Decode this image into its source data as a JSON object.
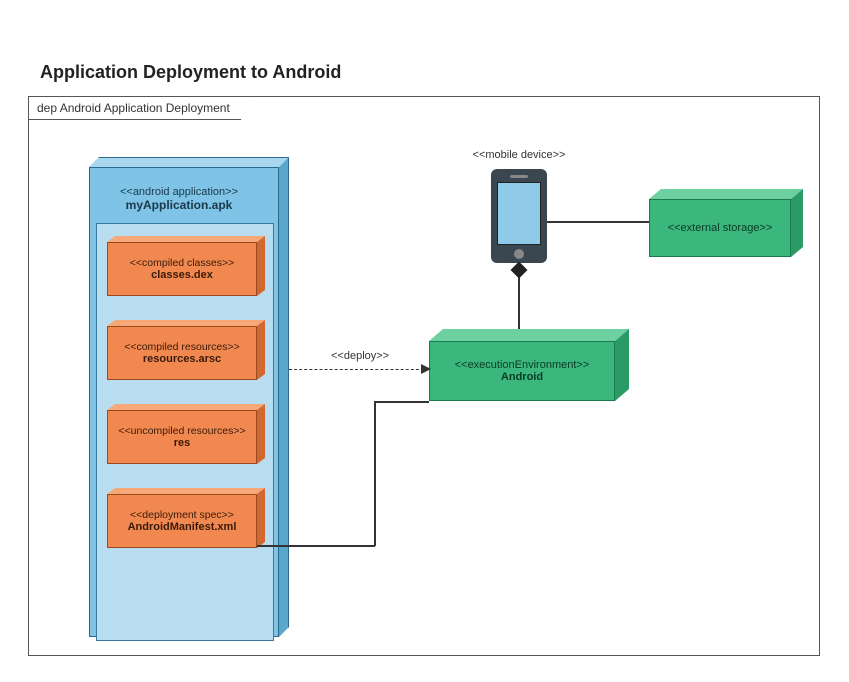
{
  "title": "Application Deployment to Android",
  "frame_label": "dep Android Application Deployment",
  "apk": {
    "stereotype": "<<android application>>",
    "name": "myApplication.apk",
    "contents": [
      {
        "stereotype": "<<compiled classes>>",
        "name": "classes.dex"
      },
      {
        "stereotype": "<<compiled resources>>",
        "name": "resources.arsc"
      },
      {
        "stereotype": "<<uncompiled resources>>",
        "name": "res"
      },
      {
        "stereotype": "<<deployment spec>>",
        "name": "AndroidManifest.xml"
      }
    ]
  },
  "device_label": "<<mobile device>>",
  "android_node": {
    "stereotype": "<<executionEnvironment>>",
    "name": "Android"
  },
  "storage_node": {
    "stereotype": "<<external storage>>"
  },
  "deploy_label": "<<deploy>>"
}
